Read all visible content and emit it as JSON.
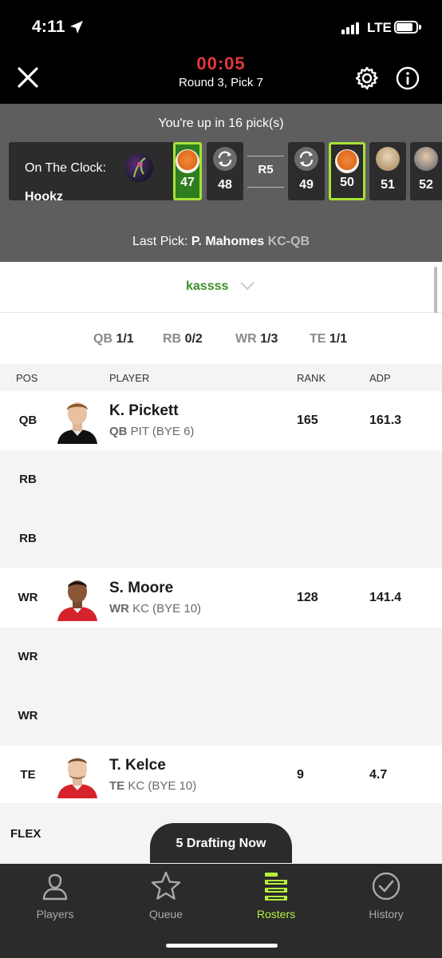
{
  "status_bar": {
    "time": "4:11",
    "network": "LTE"
  },
  "header": {
    "timer": "00:05",
    "round_pick": "Round 3, Pick 7"
  },
  "clock": {
    "up_in": "You're up in 16 pick(s)",
    "on_the_clock_label": "On The Clock:",
    "on_the_clock_user": "Hookz",
    "picks": [
      {
        "num": "47",
        "avatar": "orange-ball-avatar",
        "highlight": "green-fill"
      },
      {
        "num": "48",
        "avatar": "swap-icon",
        "highlight": "none"
      },
      {
        "num": "49",
        "avatar": "swap-icon",
        "highlight": "none"
      },
      {
        "num": "50",
        "avatar": "orange-ball-avatar",
        "highlight": "green-border"
      },
      {
        "num": "51",
        "avatar": "dog-avatar",
        "highlight": "none"
      },
      {
        "num": "52",
        "avatar": "man-avatar",
        "highlight": "none"
      }
    ],
    "round_marker": "R5",
    "last_pick_label": "Last Pick:",
    "last_pick_player": "P. Mahomes",
    "last_pick_pos": "KC-QB"
  },
  "team_selector": {
    "name": "kassss"
  },
  "position_counts": [
    {
      "pos": "QB",
      "count": "1/1"
    },
    {
      "pos": "RB",
      "count": "0/2"
    },
    {
      "pos": "WR",
      "count": "1/3"
    },
    {
      "pos": "TE",
      "count": "1/1"
    }
  ],
  "table": {
    "headers": {
      "pos": "POS",
      "player": "PLAYER",
      "rank": "RANK",
      "adp": "ADP"
    },
    "rows": [
      {
        "slot": "QB",
        "name": "K. Pickett",
        "pos": "QB",
        "team_bye": "PIT (BYE 6)",
        "rank": "165",
        "adp": "161.3"
      },
      {
        "slot": "RB",
        "name": "",
        "pos": "",
        "team_bye": "",
        "rank": "",
        "adp": ""
      },
      {
        "slot": "RB",
        "name": "",
        "pos": "",
        "team_bye": "",
        "rank": "",
        "adp": ""
      },
      {
        "slot": "WR",
        "name": "S. Moore",
        "pos": "WR",
        "team_bye": "KC (BYE 10)",
        "rank": "128",
        "adp": "141.4"
      },
      {
        "slot": "WR",
        "name": "",
        "pos": "",
        "team_bye": "",
        "rank": "",
        "adp": ""
      },
      {
        "slot": "WR",
        "name": "",
        "pos": "",
        "team_bye": "",
        "rank": "",
        "adp": ""
      },
      {
        "slot": "TE",
        "name": "T. Kelce",
        "pos": "TE",
        "team_bye": "KC (BYE 10)",
        "rank": "9",
        "adp": "4.7"
      }
    ],
    "flex_slot": "FLEX"
  },
  "drafting_now": "5 Drafting Now",
  "bottom_nav": [
    {
      "label": "Players",
      "icon": "person-icon",
      "active": false
    },
    {
      "label": "Queue",
      "icon": "star-icon",
      "active": false
    },
    {
      "label": "Rosters",
      "icon": "roster-icon",
      "active": true
    },
    {
      "label": "History",
      "icon": "check-circle-icon",
      "active": false
    }
  ],
  "colors": {
    "accent_green": "#b6f23c",
    "timer_red": "#e5383b",
    "team_green": "#3b8e2a"
  }
}
